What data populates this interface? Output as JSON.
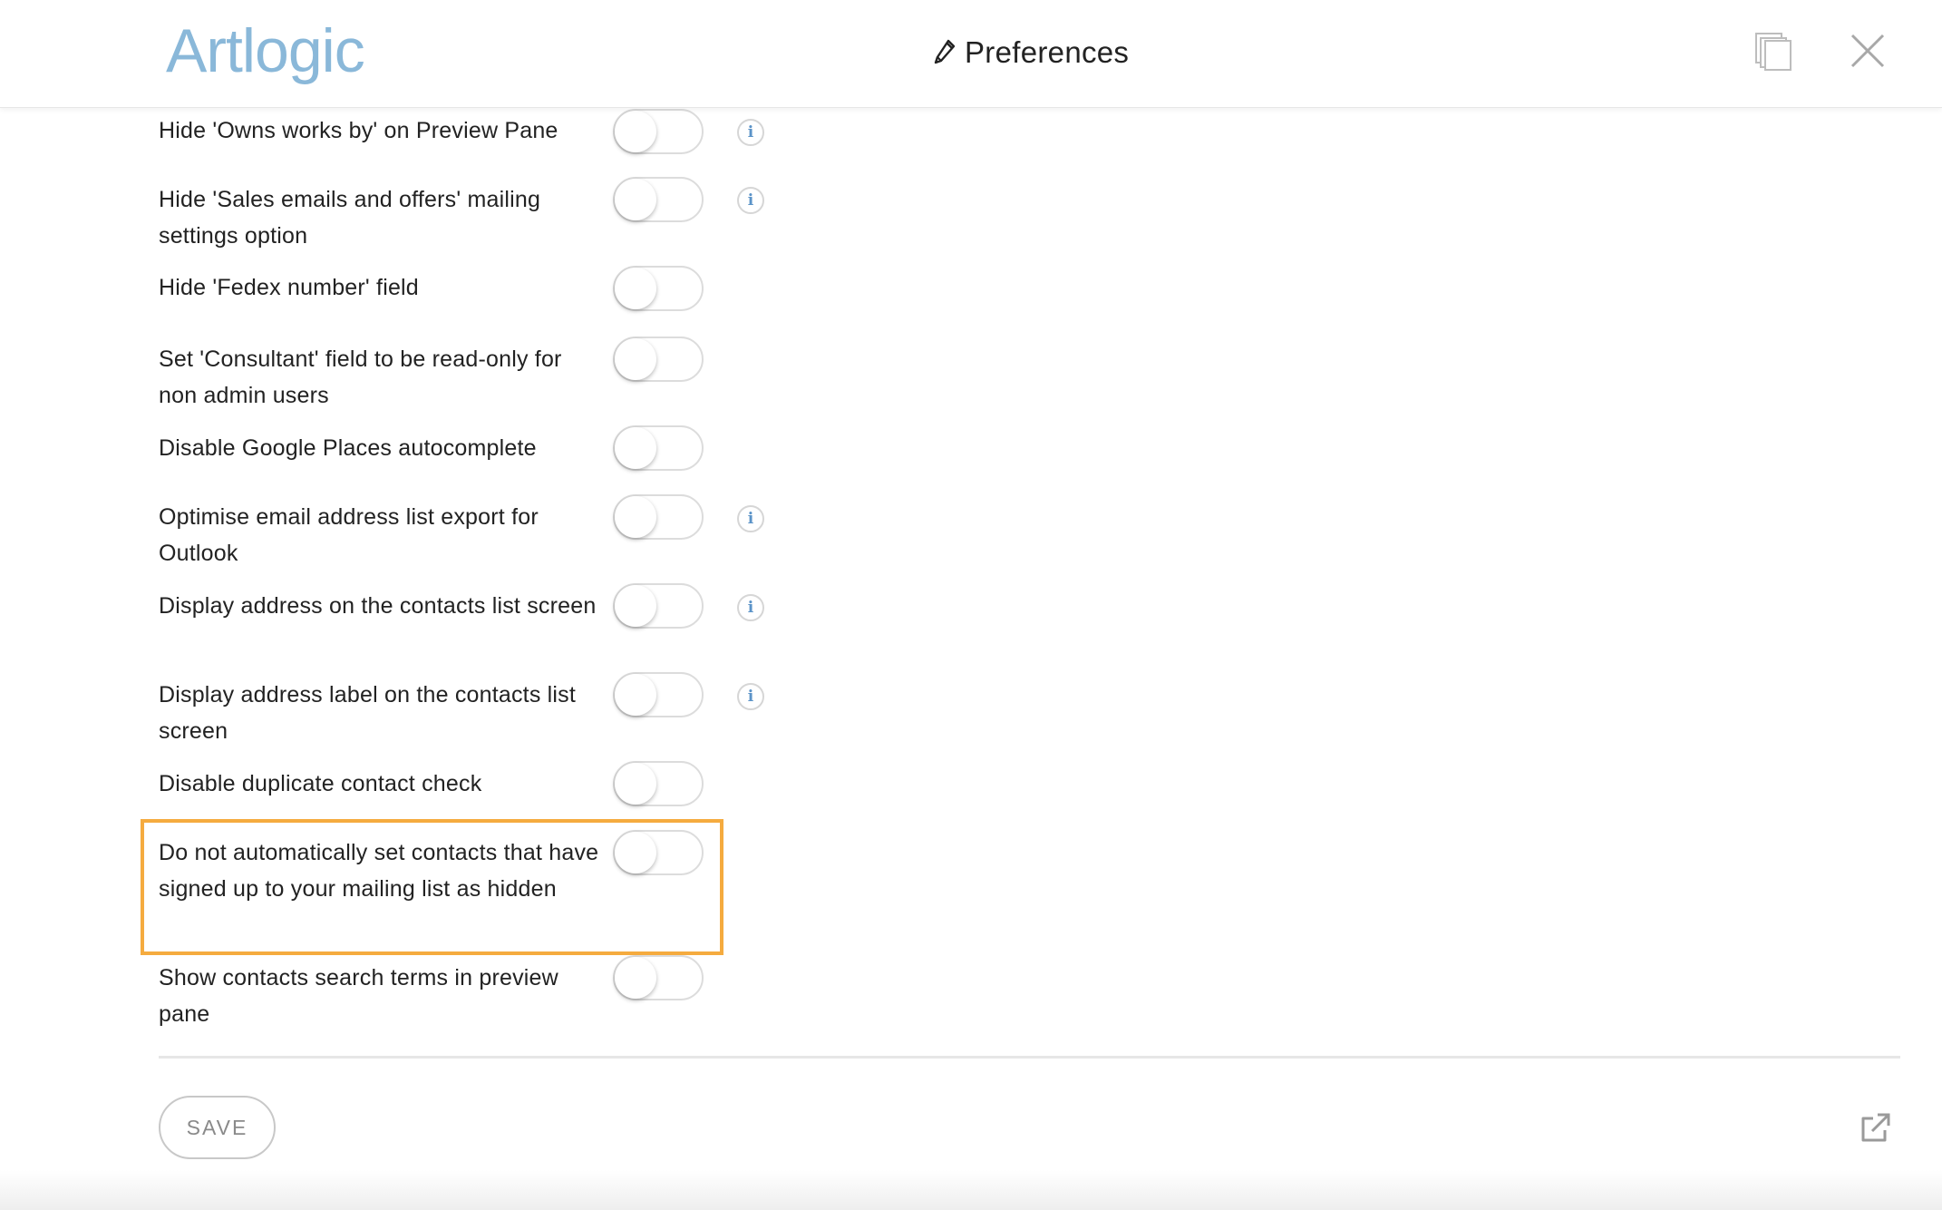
{
  "header": {
    "logo": "Artlogic",
    "title": "Preferences",
    "icons": {
      "title": "pencil-icon",
      "copy": "copy-icon",
      "close": "close-icon"
    }
  },
  "settings": [
    {
      "label": "Hide 'Owns works by' on Preview Pane",
      "enabled": false,
      "info": true
    },
    {
      "label": "Hide 'Sales emails and offers' mailing settings option",
      "enabled": false,
      "info": true
    },
    {
      "label": "Hide 'Fedex number' field",
      "enabled": false,
      "info": false
    },
    {
      "label": "Set 'Consultant' field to be read-only for non admin users",
      "enabled": false,
      "info": false
    },
    {
      "label": "Disable Google Places autocomplete",
      "enabled": false,
      "info": false
    },
    {
      "label": "Optimise email address list export for Outlook",
      "enabled": false,
      "info": true
    },
    {
      "label": "Display address on the contacts list screen",
      "enabled": false,
      "info": true
    },
    {
      "label": "Display address label on the contacts list screen",
      "enabled": false,
      "info": true
    },
    {
      "label": "Disable duplicate contact check",
      "enabled": false,
      "info": false
    },
    {
      "label": "Do not automatically set contacts that have signed up to your mailing list as hidden",
      "enabled": false,
      "info": false,
      "highlighted": true
    },
    {
      "label": "Show contacts search terms in preview pane",
      "enabled": false,
      "info": false
    }
  ],
  "info_glyph": "i",
  "footer": {
    "save_label": "SAVE",
    "external_icon": "external-link-icon"
  },
  "colors": {
    "logo": "#8ab8d9",
    "highlight": "#f5ab3f",
    "info": "#5b93c8"
  }
}
